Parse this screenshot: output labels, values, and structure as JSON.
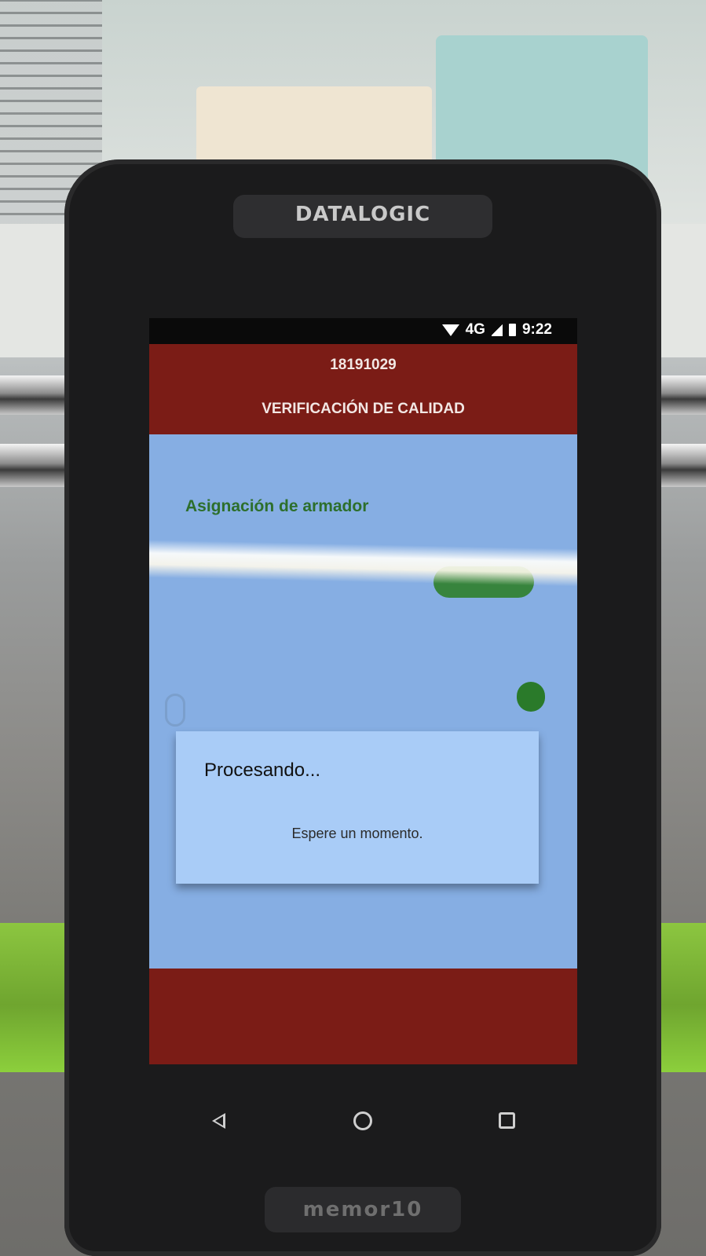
{
  "device": {
    "brand_top": "DATALOGIC",
    "brand_bottom": "memor10"
  },
  "status_bar": {
    "network": "4G",
    "time": "9:22",
    "icons": [
      "wifi-icon",
      "signal-icon",
      "battery-icon"
    ]
  },
  "app": {
    "header": {
      "id": "18191029",
      "title": "VERIFICACIÓN DE CALIDAD"
    },
    "section_title": "Asignación de armador",
    "footer_color": "#7b1c16"
  },
  "dialog": {
    "title": "Procesando...",
    "message": "Espere un momento."
  },
  "nav_bar": {
    "icons": [
      "back-icon",
      "home-icon",
      "recents-icon"
    ]
  },
  "colors": {
    "header_bg": "#7b1c16",
    "content_bg": "#86aee3",
    "dialog_bg": "#a9ccf7",
    "section_title": "#2d6f2c"
  }
}
